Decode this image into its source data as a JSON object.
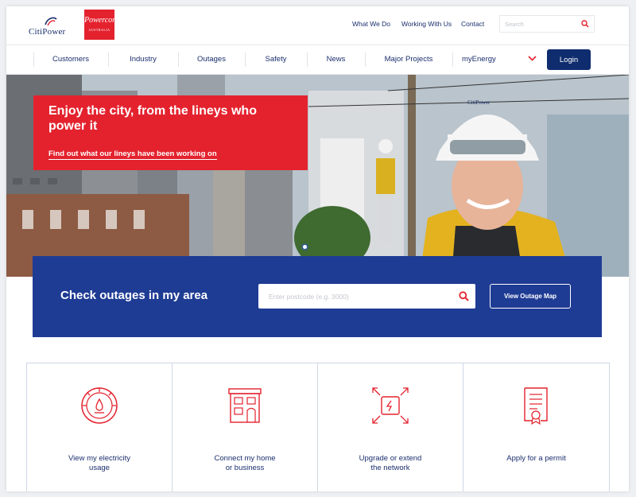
{
  "brand": {
    "citipower": "CitiPower",
    "powercor": "Powercor",
    "powercor_sub": "AUSTRALIA"
  },
  "top_links": [
    "What We Do",
    "Working With Us",
    "Contact"
  ],
  "search": {
    "placeholder": "Search"
  },
  "nav": {
    "items": [
      "Customers",
      "Industry",
      "Outages",
      "Safety",
      "News",
      "Major Projects",
      "myEnergy"
    ],
    "login": "Login"
  },
  "hero": {
    "helmet_text": "CitiPower",
    "headline": "Enjoy the city, from the lineys who power it",
    "link": "Find out what our lineys have been working on",
    "slides_total": 1,
    "active_slide": 1
  },
  "outage": {
    "title": "Check outages in my area",
    "postcode_placeholder": "Enter postcode (e.g. 3000)",
    "map_button": "View Outage Map"
  },
  "tiles": [
    {
      "icon": "gauge-icon",
      "line1": "View my electricity",
      "line2": "usage"
    },
    {
      "icon": "house-icon",
      "line1": "Connect my home",
      "line2": "or business"
    },
    {
      "icon": "network-expand-icon",
      "line1": "Upgrade or extend",
      "line2": "the network"
    },
    {
      "icon": "permit-certificate-icon",
      "line1": "Apply for a permit",
      "line2": ""
    }
  ],
  "colors": {
    "brand_red": "#e4222e",
    "navy": "#1b2f6e",
    "band_blue": "#1f3c94",
    "login_blue": "#0f2d6e"
  }
}
